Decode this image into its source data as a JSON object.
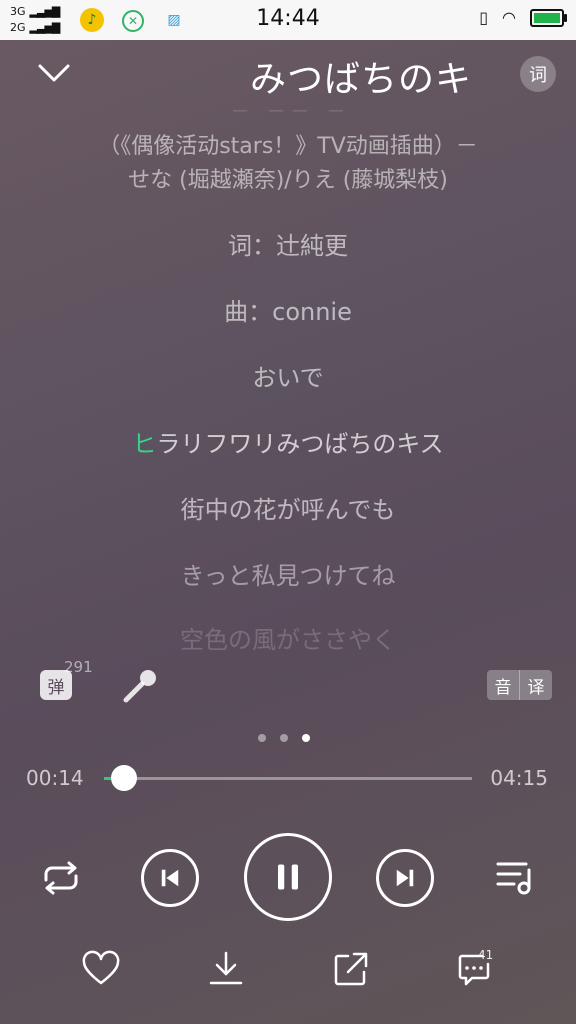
{
  "status_bar": {
    "net1": "3G",
    "net2": "2G",
    "time": "14:44"
  },
  "header": {
    "title": "みつばちのキ",
    "lyrics_button": "词"
  },
  "lyrics": {
    "faded_top": "（《偶像活动stars！》TV动画插曲）",
    "credit_line1": "（《偶像活动stars！》TV动画插曲）－",
    "credit_line2": "せな (堀越瀬奈)/りえ (藤城梨枝)",
    "lyricist": "词：辻純更",
    "composer": "曲：connie",
    "lines": [
      "おいで",
      "ラリフワリみつばちのキス",
      "街中の花が呼んでも",
      "きっと私見つけてね",
      "空色の風がささやく"
    ],
    "active_first_char": "ヒ"
  },
  "controls": {
    "danmu_label": "弹",
    "danmu_count": "291",
    "sound_label": "音",
    "translate_label": "译",
    "page_count": 3,
    "active_page": 3
  },
  "progress": {
    "current": "00:14",
    "total": "04:15",
    "fraction": 0.055
  },
  "bottom": {
    "comment_count": "41"
  },
  "colors": {
    "accent": "#34c97a",
    "highlight": "#36d38a"
  }
}
